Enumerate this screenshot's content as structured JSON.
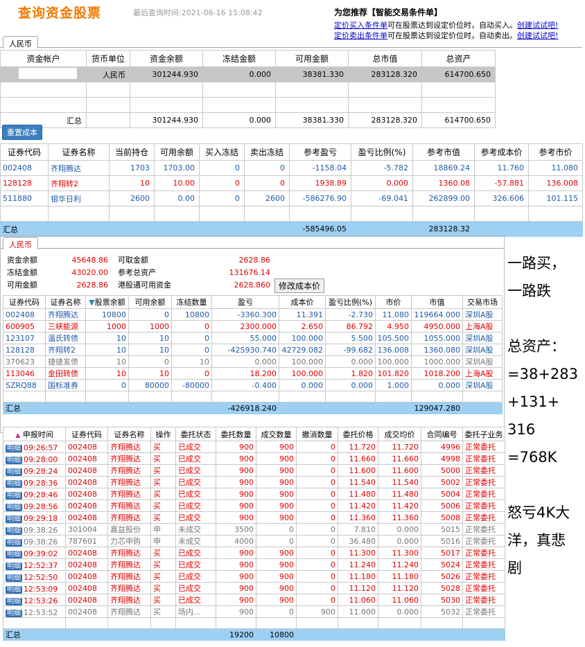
{
  "header": {
    "title": "查询资金股票",
    "query_time": "最后查询时间:2021-06-16 15:08:42",
    "rec_title": "为您推荐【智能交易条件单】",
    "rec1_a": "定价买入条件单",
    "rec1_b": "可在股票达到设定价位时，自动买入。",
    "rec1_link": "创建试试吧!",
    "rec2_a": "定价卖出条件单",
    "rec2_b": "可在股票达到设定价位时，自动卖出。",
    "rec2_link": "创建试试吧!"
  },
  "fund_tab": "人民币",
  "fund_table": {
    "headers": [
      "资金帐户",
      "货币单位",
      "资金余额",
      "冻结金额",
      "可用金额",
      "总市值",
      "总资产"
    ],
    "row": [
      "",
      "人民币",
      "301244.930",
      "0.000",
      "38381.330",
      "283128.320",
      "614700.650"
    ],
    "total": [
      "汇总",
      "",
      "301244.930",
      "0.000",
      "38381.330",
      "283128.320",
      "614700.650"
    ]
  },
  "reset_btn": "重置成本",
  "stock_table": {
    "headers": [
      "证券代码",
      "证券名称",
      "当前持仓",
      "可用余额",
      "买入冻结",
      "卖出冻结",
      "参考盈亏",
      "盈亏比例(%)",
      "参考市值",
      "参考成本价",
      "参考市价"
    ],
    "rows": [
      [
        "002408",
        "齐翔腾达",
        "1703",
        "1703.00",
        "0",
        "0",
        "-1158.04",
        "-5.782",
        "18869.24",
        "11.760",
        "11.080"
      ],
      [
        "128128",
        "齐翔转2",
        "10",
        "10.00",
        "0",
        "0",
        "1938.89",
        "0.000",
        "1360.08",
        "-57.881",
        "136.008"
      ],
      [
        "511880",
        "银华日利",
        "2600",
        "0.00",
        "0",
        "2600",
        "-586276.90",
        "-69.041",
        "262899.00",
        "326.606",
        "101.115"
      ]
    ],
    "total_label": "汇总",
    "total_pl": "-585496.05",
    "total_mv": "283128.32"
  },
  "panel2": {
    "tab": "人民币",
    "l1": "资金余额",
    "v1": "45648.86",
    "l2": "可取金额",
    "v2": "2628.86",
    "l3": "冻结金额",
    "v3": "43020.00",
    "l4": "参考总资产",
    "v4": "131676.14",
    "l5": "可用金额",
    "v5": "2628.86",
    "l6": "港股通可用资金",
    "v6": "2628.860",
    "btn": "修改成本价"
  },
  "hold_table": {
    "headers": [
      "证券代码",
      "证券名称",
      "股票余额",
      "可用余额",
      "冻结数量",
      "盈亏",
      "成本价",
      "盈亏比例(%)",
      "市价",
      "市值",
      "交易市场"
    ],
    "rows": [
      [
        "002408",
        "齐翔腾达",
        "10800",
        "0",
        "10800",
        "-3360.300",
        "11.391",
        "-2.730",
        "11.080",
        "119664.000",
        "深圳A股"
      ],
      [
        "600905",
        "三峡能源",
        "1000",
        "1000",
        "0",
        "2300.000",
        "2.650",
        "86.792",
        "4.950",
        "4950.000",
        "上海A股"
      ],
      [
        "123107",
        "温氏转债",
        "10",
        "10",
        "0",
        "55.000",
        "100.000",
        "5.500",
        "105.500",
        "1055.000",
        "深圳A股"
      ],
      [
        "128128",
        "齐翔转2",
        "10",
        "10",
        "0",
        "-425930.740",
        "42729.082",
        "-99.682",
        "136.008",
        "1360.080",
        "深圳A股"
      ],
      [
        "370623",
        "捷捷发债",
        "10",
        "0",
        "10",
        "0.000",
        "100.000",
        "0.000",
        "100.000",
        "1000.000",
        "深圳A股"
      ],
      [
        "113046",
        "金田转债",
        "10",
        "10",
        "0",
        "18.200",
        "100.000",
        "1.820",
        "101.820",
        "1018.200",
        "上海A股"
      ],
      [
        "SZRQ88",
        "国标准券",
        "0",
        "80000",
        "-80000",
        "-0.400",
        "0.000",
        "0.000",
        "1.000",
        "0.000",
        "深圳A股"
      ]
    ],
    "total_label": "汇总",
    "total_pl": "-426918.240",
    "total_mv": "129047.280"
  },
  "order_table": {
    "headers": [
      "申报时间",
      "证券代码",
      "证券名称",
      "操作",
      "委托状态",
      "委托数量",
      "成交数量",
      "撤消数量",
      "委托价格",
      "成交均价",
      "合同编号",
      "委托子业务"
    ],
    "detail": "明细",
    "rows": [
      [
        "09:26:57",
        "002408",
        "齐翔腾达",
        "买",
        "已成交",
        "900",
        "900",
        "0",
        "11.720",
        "11.720",
        "4996",
        "正常委托"
      ],
      [
        "09:28:00",
        "002408",
        "齐翔腾达",
        "买",
        "已成交",
        "900",
        "900",
        "0",
        "11.660",
        "11.660",
        "4998",
        "正常委托"
      ],
      [
        "09:28:24",
        "002408",
        "齐翔腾达",
        "买",
        "已成交",
        "900",
        "900",
        "0",
        "11.600",
        "11.600",
        "5000",
        "正常委托"
      ],
      [
        "09:28:36",
        "002408",
        "齐翔腾达",
        "买",
        "已成交",
        "900",
        "900",
        "0",
        "11.540",
        "11.540",
        "5002",
        "正常委托"
      ],
      [
        "09:28:46",
        "002408",
        "齐翔腾达",
        "买",
        "已成交",
        "900",
        "900",
        "0",
        "11.480",
        "11.480",
        "5004",
        "正常委托"
      ],
      [
        "09:28:56",
        "002408",
        "齐翔腾达",
        "买",
        "已成交",
        "900",
        "900",
        "0",
        "11.420",
        "11.420",
        "5006",
        "正常委托"
      ],
      [
        "09:29:18",
        "002408",
        "齐翔腾达",
        "买",
        "已成交",
        "900",
        "900",
        "0",
        "11.360",
        "11.360",
        "5008",
        "正常委托"
      ],
      [
        "09:38:26",
        "301004",
        "嘉益股份",
        "申",
        "未成交",
        "3500",
        "0",
        "0",
        "7.810",
        "0.000",
        "5015",
        "正常委托"
      ],
      [
        "09:38:26",
        "787601",
        "力芯申购",
        "申",
        "未成交",
        "4000",
        "0",
        "0",
        "36.480",
        "0.000",
        "5016",
        "正常委托"
      ],
      [
        "09:39:02",
        "002408",
        "齐翔腾达",
        "买",
        "已成交",
        "900",
        "900",
        "0",
        "11.300",
        "11.300",
        "5017",
        "正常委托"
      ],
      [
        "12:52:37",
        "002408",
        "齐翔腾达",
        "买",
        "已成交",
        "900",
        "900",
        "0",
        "11.240",
        "11.240",
        "5024",
        "正常委托"
      ],
      [
        "12:52:50",
        "002408",
        "齐翔腾达",
        "买",
        "已成交",
        "900",
        "900",
        "0",
        "11.180",
        "11.180",
        "5026",
        "正常委托"
      ],
      [
        "12:53:09",
        "002408",
        "齐翔腾达",
        "买",
        "已成交",
        "900",
        "900",
        "0",
        "11.120",
        "11.120",
        "5028",
        "正常委托"
      ],
      [
        "12:53:26",
        "002408",
        "齐翔腾达",
        "买",
        "已成交",
        "900",
        "900",
        "0",
        "11.060",
        "11.060",
        "5030",
        "正常委托"
      ],
      [
        "12:53:52",
        "002408",
        "齐翔腾达",
        "买",
        "场内...",
        "900",
        "0",
        "900",
        "11.000",
        "0.000",
        "5032",
        "正常委托"
      ]
    ],
    "total_label": "汇总",
    "total_qty": "19200",
    "total_done": "10800"
  },
  "note": [
    "一路买，",
    "一路跌",
    "",
    "总资产：",
    "=38+283",
    "+131+",
    "316",
    "=768K",
    "",
    "怒亏4K大",
    "洋，真悲",
    "剧"
  ]
}
